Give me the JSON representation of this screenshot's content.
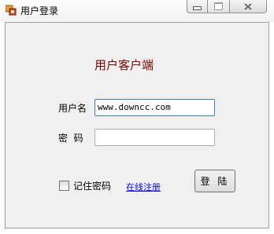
{
  "window": {
    "title": "用户登录",
    "controls": [
      "minimize",
      "maximize",
      "close"
    ]
  },
  "form": {
    "heading": "用户客户端",
    "username_label": "用户名",
    "username_value": "www.downcc.com",
    "password_label": "密  码",
    "password_value": "",
    "remember_label": "记住密码",
    "remember_checked": false,
    "register_link": "在线注册",
    "login_button": "登 陆"
  },
  "colors": {
    "heading": "#800000",
    "link": "#0000ff",
    "client_bg": "#f0f0f0"
  },
  "icons": {
    "app": "app-window-icon",
    "minimize": "minimize-icon",
    "maximize": "maximize-icon",
    "close": "close-icon"
  }
}
